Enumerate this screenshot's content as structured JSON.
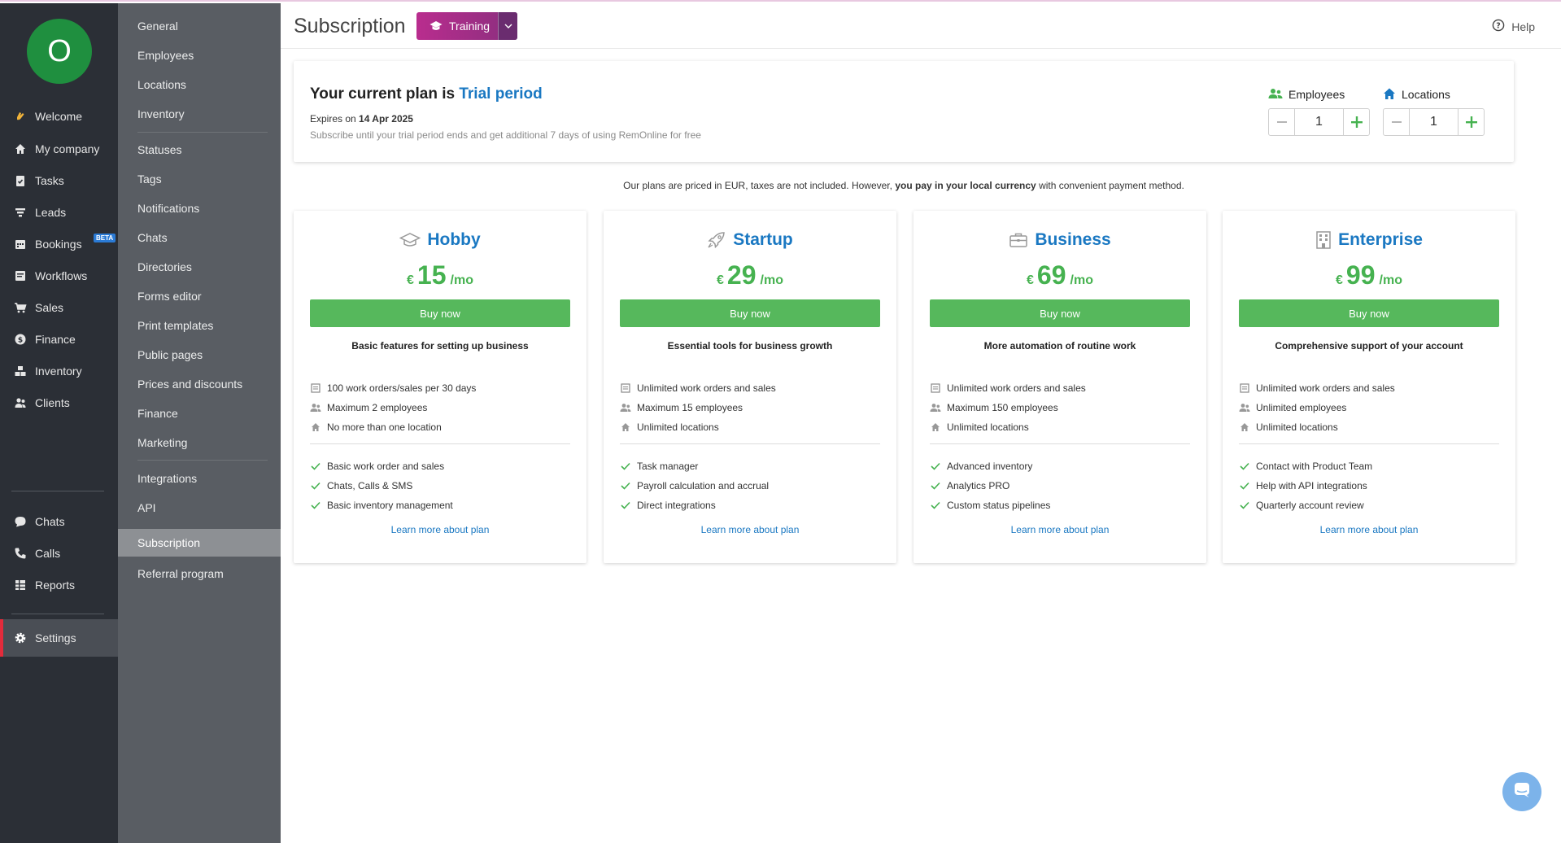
{
  "nav": {
    "avatar_letter": "O",
    "items": [
      {
        "label": "Welcome",
        "icon": "wave-hand-icon"
      },
      {
        "label": "My company",
        "icon": "home-icon"
      },
      {
        "label": "Tasks",
        "icon": "clipboard-check-icon"
      },
      {
        "label": "Leads",
        "icon": "funnel-icon"
      },
      {
        "label": "Bookings",
        "icon": "calendar-icon"
      },
      {
        "label": "Workflows",
        "icon": "workflow-icon"
      },
      {
        "label": "Sales",
        "icon": "cart-icon"
      },
      {
        "label": "Finance",
        "icon": "dollar-coin-icon"
      },
      {
        "label": "Inventory",
        "icon": "boxes-icon"
      },
      {
        "label": "Clients",
        "icon": "users-icon"
      },
      {
        "label": "Chats",
        "icon": "chat-bubble-icon"
      },
      {
        "label": "Calls",
        "icon": "phone-icon"
      },
      {
        "label": "Reports",
        "icon": "table-icon"
      },
      {
        "label": "Settings",
        "icon": "gear-icon"
      }
    ],
    "beta_badge": "BETA"
  },
  "subnav": {
    "items": [
      "General",
      "Employees",
      "Locations",
      "Inventory",
      "Statuses",
      "Tags",
      "Notifications",
      "Chats",
      "Directories",
      "Forms editor",
      "Print templates",
      "Public pages",
      "Prices and discounts",
      "Finance",
      "Marketing",
      "Integrations",
      "API",
      "Subscription",
      "Referral program"
    ],
    "active": "Subscription"
  },
  "header": {
    "title": "Subscription",
    "training_label": "Training",
    "help_label": "Help"
  },
  "current_plan": {
    "title_prefix": "Your current plan is",
    "plan_name": "Trial period",
    "expires_prefix": "Expires on",
    "expires_date": "14 Apr 2025",
    "note": "Subscribe until your trial period ends and get additional 7 days of using RemOnline for free",
    "employees_label": "Employees",
    "employees_value": "1",
    "locations_label": "Locations",
    "locations_value": "1"
  },
  "pricing_note": {
    "part1": "Our plans are priced in EUR, taxes are not included. However,",
    "bold": "you pay in your local currency",
    "part2": "with convenient payment method."
  },
  "plans": [
    {
      "name": "Hobby",
      "icon": "graduation-cap-icon",
      "currency": "€",
      "price": "15",
      "per": "/mo",
      "buy_label": "Buy now",
      "tagline": "Basic features for setting up business",
      "limits": [
        "100 work orders/sales per 30 days",
        "Maximum 2 employees",
        "No more than one location"
      ],
      "features": [
        "Basic work order and sales",
        "Chats, Calls & SMS",
        "Basic inventory management"
      ],
      "learn_more": "Learn more about plan"
    },
    {
      "name": "Startup",
      "icon": "rocket-icon",
      "currency": "€",
      "price": "29",
      "per": "/mo",
      "buy_label": "Buy now",
      "tagline": "Essential tools for business growth",
      "limits": [
        "Unlimited work orders and sales",
        "Maximum 15 employees",
        "Unlimited locations"
      ],
      "features": [
        "Task manager",
        "Payroll calculation and accrual",
        "Direct integrations"
      ],
      "learn_more": "Learn more about plan"
    },
    {
      "name": "Business",
      "icon": "briefcase-icon",
      "currency": "€",
      "price": "69",
      "per": "/mo",
      "buy_label": "Buy now",
      "tagline": "More automation of routine work",
      "limits": [
        "Unlimited work orders and sales",
        "Maximum 150 employees",
        "Unlimited locations"
      ],
      "features": [
        "Advanced inventory",
        "Analytics PRO",
        "Custom status pipelines"
      ],
      "learn_more": "Learn more about plan"
    },
    {
      "name": "Enterprise",
      "icon": "building-icon",
      "currency": "€",
      "price": "99",
      "per": "/mo",
      "buy_label": "Buy now",
      "tagline": "Comprehensive support of your account",
      "limits": [
        "Unlimited work orders and sales",
        "Unlimited employees",
        "Unlimited locations"
      ],
      "features": [
        "Contact with Product Team",
        "Help with API integrations",
        "Quarterly account review"
      ],
      "learn_more": "Learn more about plan"
    }
  ],
  "colors": {
    "nav_bg": "#2b2f36",
    "subnav_bg": "#595d63",
    "accent_blue": "#1a78c2",
    "price_green": "#46b250",
    "button_green": "#56b85c",
    "active_marker": "#e32b3b",
    "training_gradient_start": "#b92d8e"
  }
}
